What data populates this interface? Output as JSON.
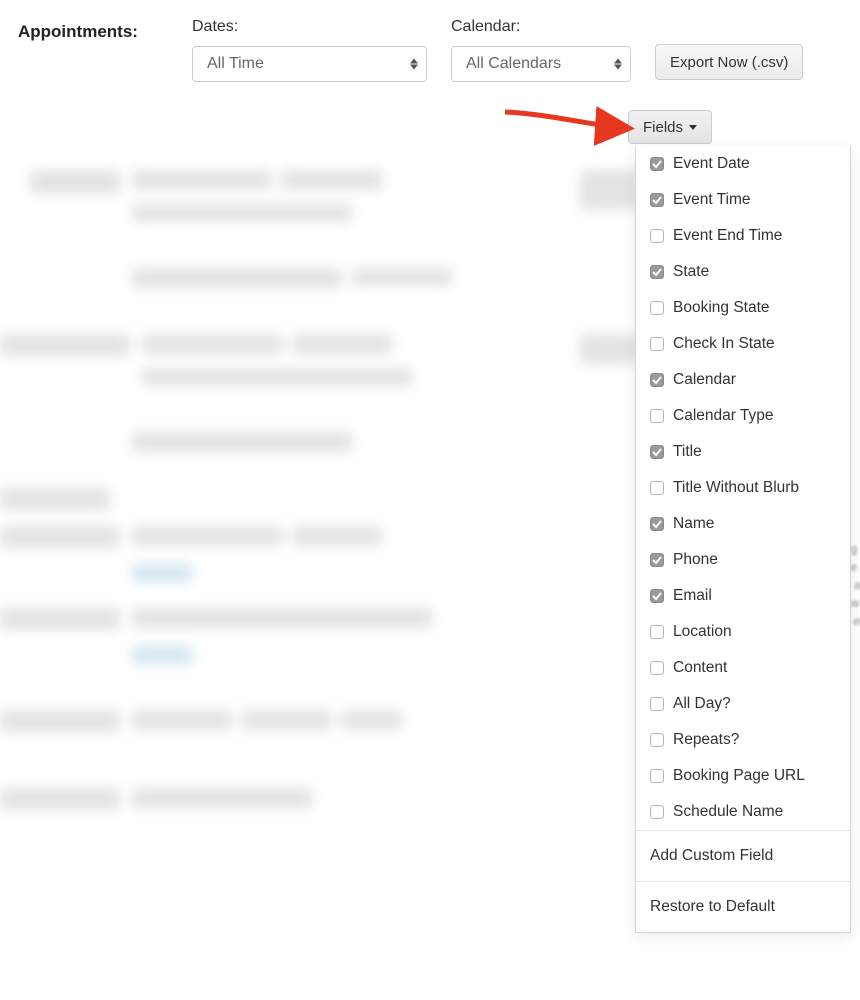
{
  "header": {
    "section_label": "Appointments:",
    "dates_label": "Dates:",
    "dates_value": "All Time",
    "calendar_label": "Calendar:",
    "calendar_value": "All Calendars",
    "export_button": "Export Now (.csv)"
  },
  "fields_button": "Fields",
  "fields": [
    {
      "label": "Event Date",
      "checked": true
    },
    {
      "label": "Event Time",
      "checked": true
    },
    {
      "label": "Event End Time",
      "checked": false
    },
    {
      "label": "State",
      "checked": true
    },
    {
      "label": "Booking State",
      "checked": false
    },
    {
      "label": "Check In State",
      "checked": false
    },
    {
      "label": "Calendar",
      "checked": true
    },
    {
      "label": "Calendar Type",
      "checked": false
    },
    {
      "label": "Title",
      "checked": true
    },
    {
      "label": "Title Without Blurb",
      "checked": false
    },
    {
      "label": "Name",
      "checked": true
    },
    {
      "label": "Phone",
      "checked": true
    },
    {
      "label": "Email",
      "checked": true
    },
    {
      "label": "Location",
      "checked": false
    },
    {
      "label": "Content",
      "checked": false
    },
    {
      "label": "All Day?",
      "checked": false
    },
    {
      "label": "Repeats?",
      "checked": false
    },
    {
      "label": "Booking Page URL",
      "checked": false
    },
    {
      "label": "Schedule Name",
      "checked": false
    }
  ],
  "actions": {
    "add_custom": "Add Custom Field",
    "restore": "Restore to Default"
  },
  "arrow_color": "#e83720"
}
